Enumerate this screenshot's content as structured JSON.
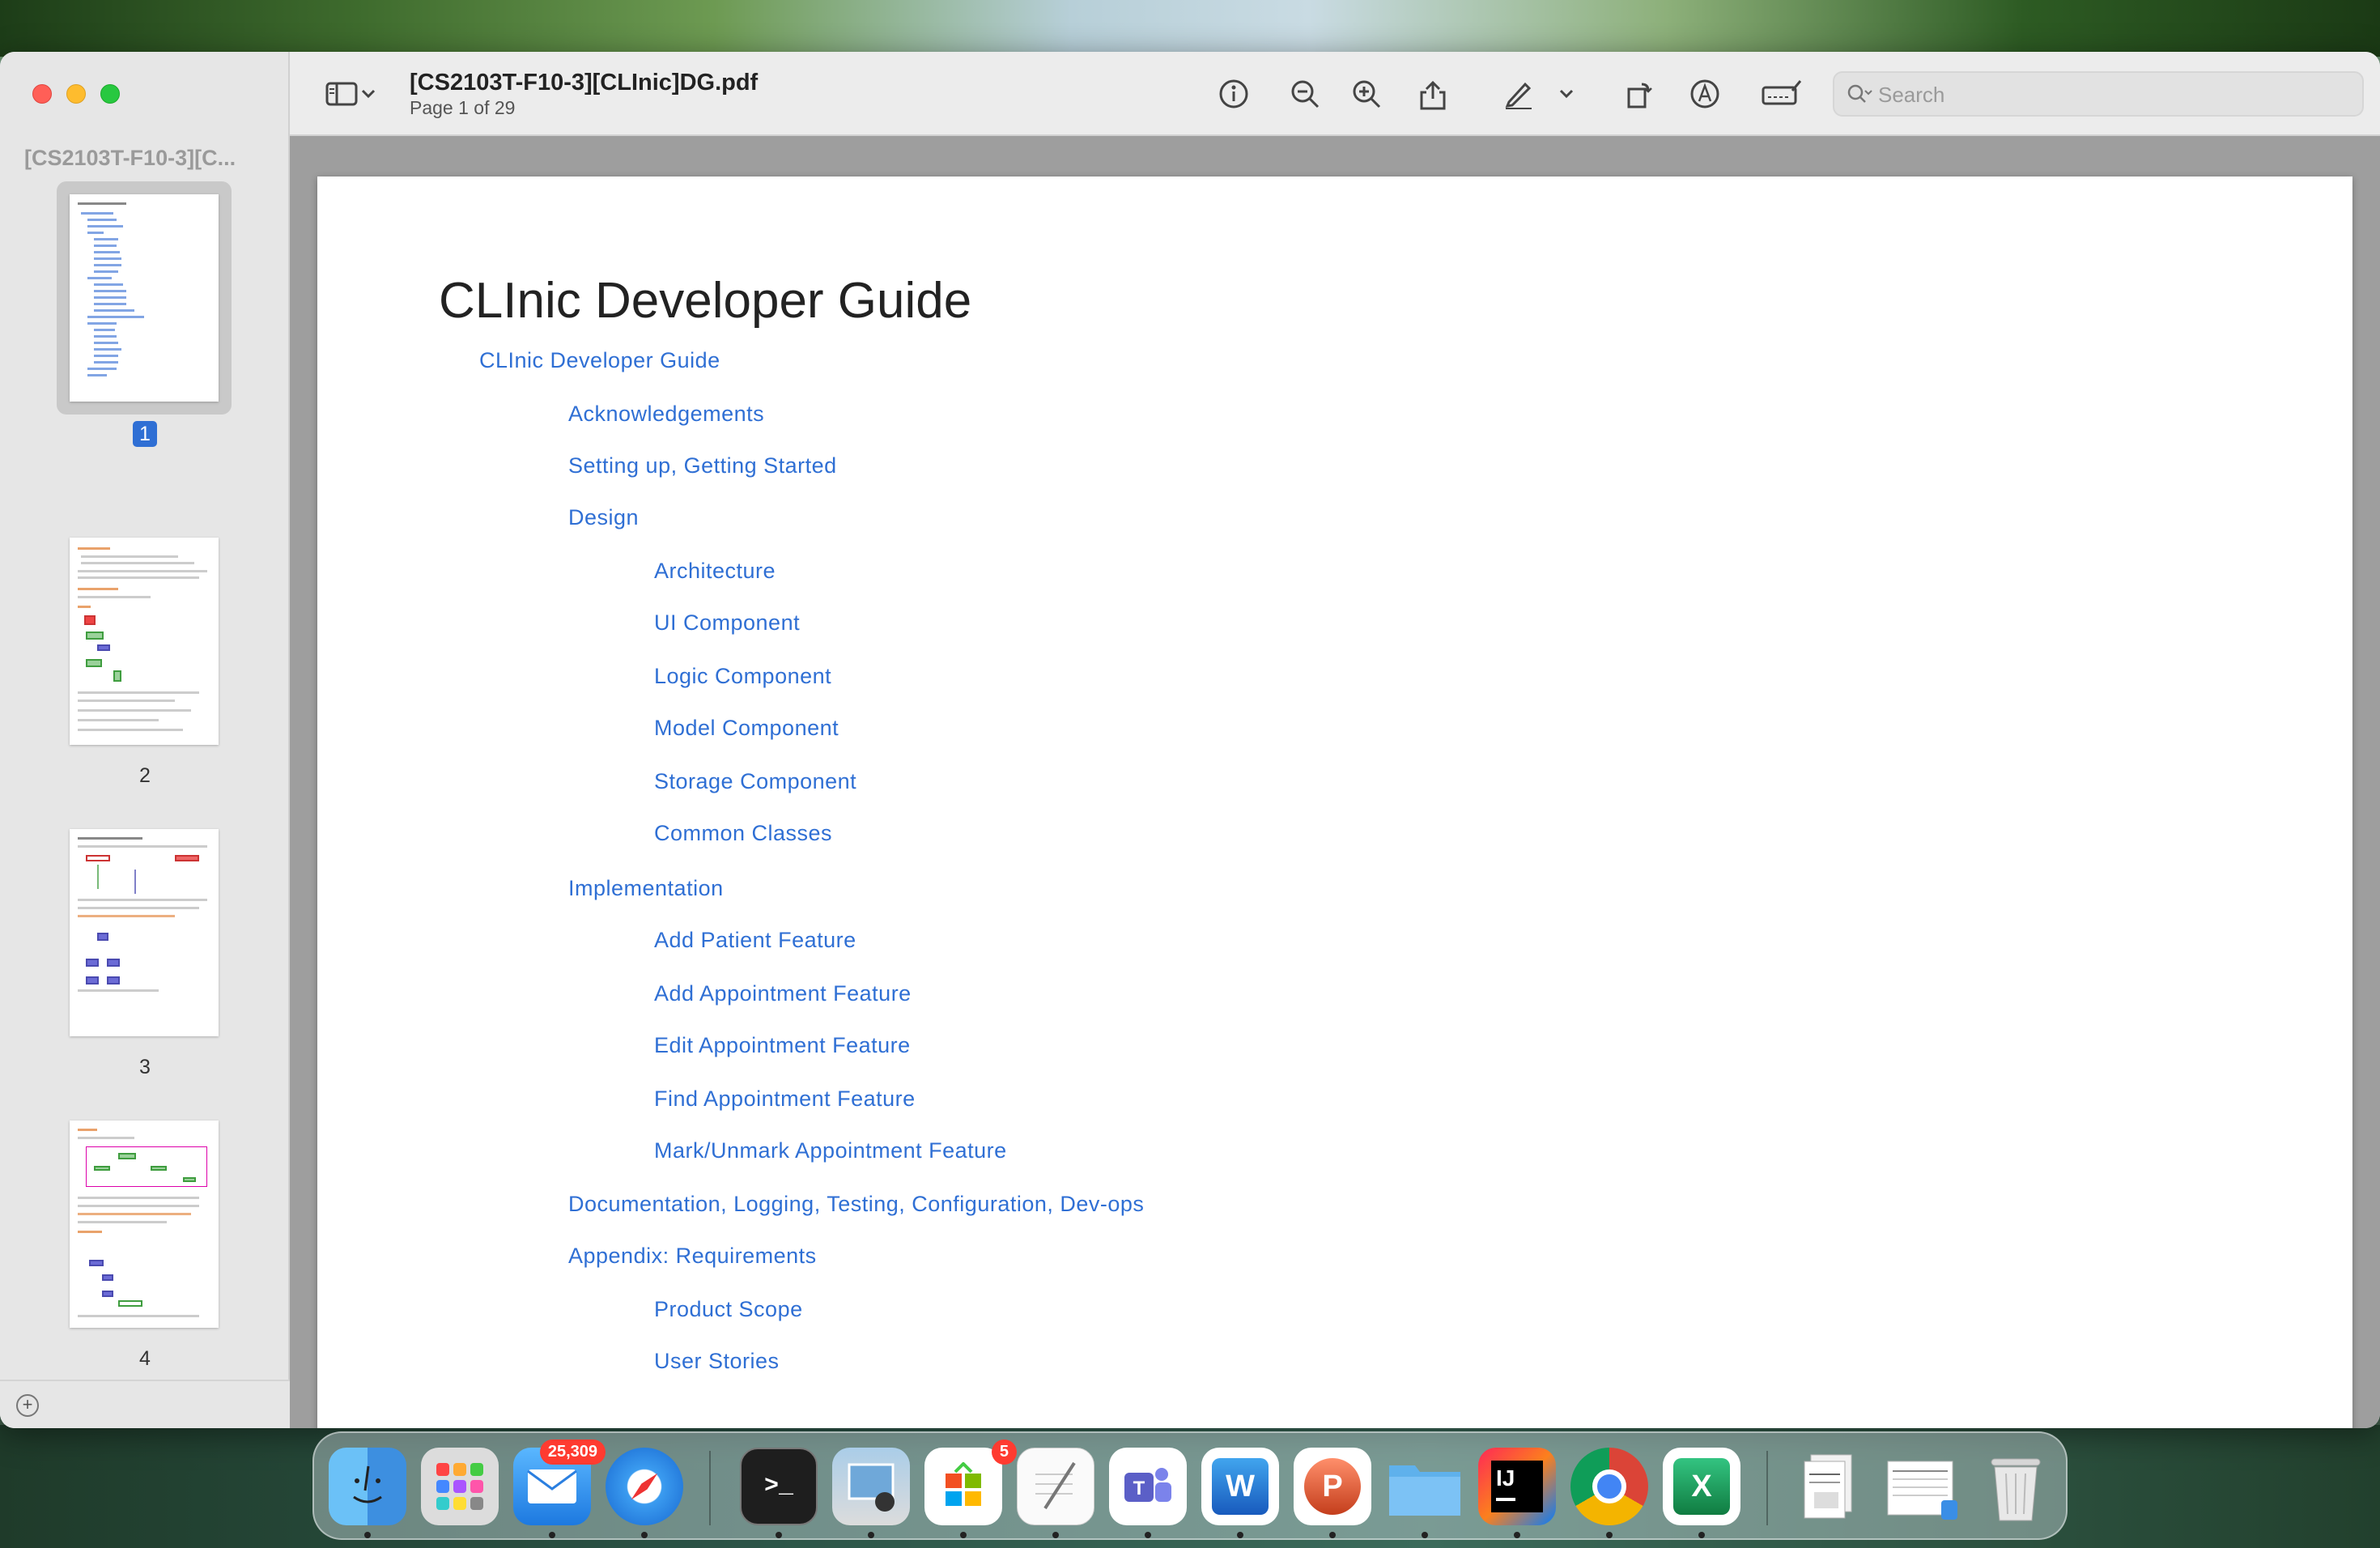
{
  "window": {
    "title": "[CS2103T-F10-3][CLInic]DG.pdf",
    "subtitle": "Page 1 of 29"
  },
  "sidebar": {
    "title": "[CS2103T-F10-3][C...",
    "pages": [
      {
        "label": "1",
        "selected": true
      },
      {
        "label": "2",
        "selected": false
      },
      {
        "label": "3",
        "selected": false
      },
      {
        "label": "4",
        "selected": false
      }
    ]
  },
  "toolbar": {
    "icons": [
      "sidebar-toggle-icon",
      "chevron-down-icon",
      "info-icon",
      "zoom-out-icon",
      "zoom-in-icon",
      "share-icon",
      "highlight-pen-icon",
      "chevron-down-icon",
      "rotate-icon",
      "markup-icon",
      "signature-icon"
    ],
    "search_placeholder": "Search"
  },
  "document": {
    "heading": "CLInic Developer Guide",
    "toc": [
      {
        "label": "CLInic Developer Guide",
        "level": 0
      },
      {
        "label": "Acknowledgements",
        "level": 1
      },
      {
        "label": "Setting up, Getting Started",
        "level": 1
      },
      {
        "label": "Design",
        "level": 1
      },
      {
        "label": "Architecture",
        "level": 2
      },
      {
        "label": "UI Component",
        "level": 2
      },
      {
        "label": "Logic Component",
        "level": 2
      },
      {
        "label": "Model Component",
        "level": 2
      },
      {
        "label": "Storage Component",
        "level": 2
      },
      {
        "label": "Common Classes",
        "level": 2
      },
      {
        "label": "Implementation",
        "level": 1
      },
      {
        "label": "Add Patient Feature",
        "level": 2
      },
      {
        "label": "Add Appointment Feature",
        "level": 2
      },
      {
        "label": "Edit Appointment Feature",
        "level": 2
      },
      {
        "label": "Find Appointment Feature",
        "level": 2
      },
      {
        "label": "Mark/Unmark Appointment Feature",
        "level": 2
      },
      {
        "label": "Documentation, Logging, Testing, Configuration, Dev-ops",
        "level": 1
      },
      {
        "label": "Appendix: Requirements",
        "level": 1
      },
      {
        "label": "Product Scope",
        "level": 2
      },
      {
        "label": "User Stories",
        "level": 2
      }
    ]
  },
  "dock": {
    "apps": [
      {
        "name": "finder-icon",
        "badge": ""
      },
      {
        "name": "launchpad-icon",
        "badge": ""
      },
      {
        "name": "mail-icon",
        "badge": "25,309"
      },
      {
        "name": "safari-icon",
        "badge": ""
      },
      {
        "name": "terminal-icon",
        "badge": ""
      },
      {
        "name": "preview-icon",
        "badge": ""
      },
      {
        "name": "microsoft-store-icon",
        "badge": "5"
      },
      {
        "name": "textedit-icon",
        "badge": ""
      },
      {
        "name": "teams-icon",
        "badge": ""
      },
      {
        "name": "word-icon",
        "badge": ""
      },
      {
        "name": "powerpoint-icon",
        "badge": ""
      },
      {
        "name": "files-folder-icon",
        "badge": ""
      },
      {
        "name": "intellij-icon",
        "badge": ""
      },
      {
        "name": "chrome-icon",
        "badge": ""
      },
      {
        "name": "excel-icon",
        "badge": ""
      },
      {
        "name": "document-stack-icon",
        "badge": ""
      },
      {
        "name": "downloads-stack-icon",
        "badge": ""
      },
      {
        "name": "trash-icon",
        "badge": ""
      }
    ],
    "terminal_glyph": ">_",
    "intellij_glyph": "IJ",
    "word_glyph": "W",
    "powerpoint_glyph": "P",
    "excel_glyph": "X"
  },
  "colors": {
    "link": "#2f6fd4",
    "selection": "#2f6fd4",
    "badge": "#ff3b30"
  }
}
